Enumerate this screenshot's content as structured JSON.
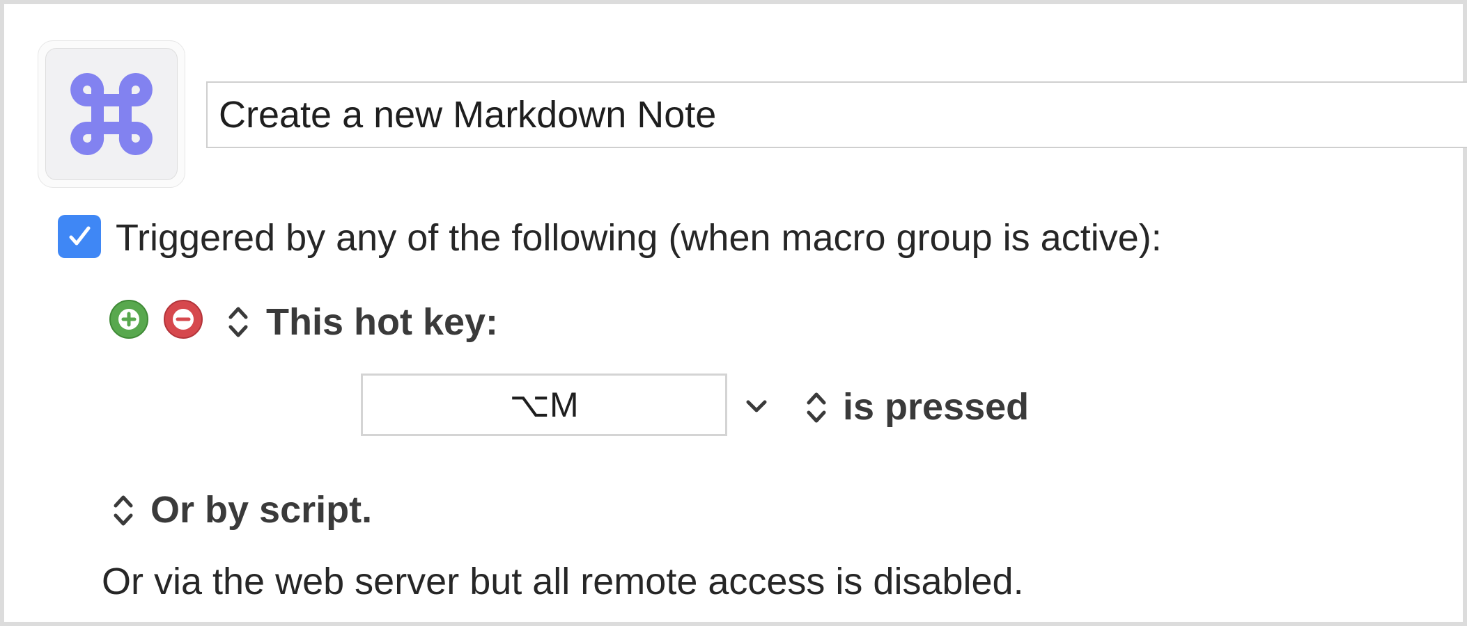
{
  "macro": {
    "icon": "command-key-icon",
    "name": "Create a new Markdown Note",
    "accent_color": "#8282f0"
  },
  "triggers": {
    "enabled": true,
    "checkbox_color": "#3f87f5",
    "label": "Triggered by any of the following (when macro group is active):",
    "add_button_icon": "plus-circle-icon",
    "remove_button_icon": "minus-circle-icon",
    "hotkey_trigger": {
      "label": "This hot key:",
      "hotkey": "⌥M",
      "condition": "is pressed"
    },
    "script_trigger_label": "Or by script.",
    "web_server_note": "Or via the web server but all remote access is disabled."
  }
}
